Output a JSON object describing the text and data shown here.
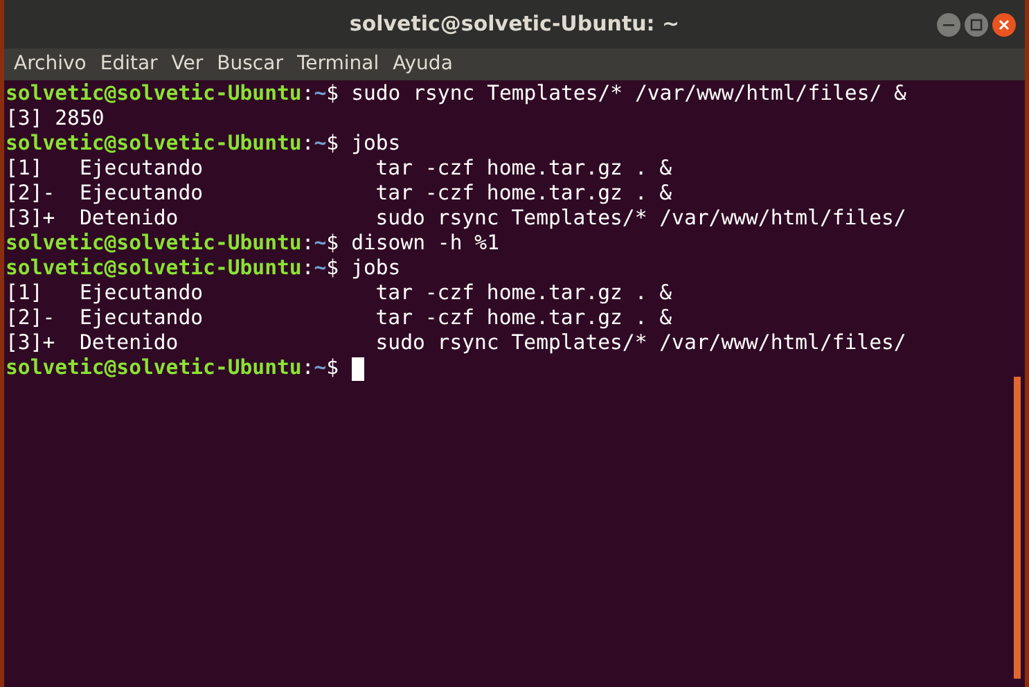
{
  "window": {
    "title": "solvetic@solvetic-Ubuntu: ~"
  },
  "menu": [
    "Archivo",
    "Editar",
    "Ver",
    "Buscar",
    "Terminal",
    "Ayuda"
  ],
  "terminal": {
    "lines": [
      {
        "kind": "prompt",
        "user_host": "solvetic@solvetic-Ubuntu",
        "separator": ":",
        "dir": "~",
        "symbol": "$",
        "command": "sudo rsync Templates/* /var/www/html/files/ &",
        "cursor": false
      },
      {
        "kind": "output",
        "text": "[3] 2850"
      },
      {
        "kind": "prompt",
        "user_host": "solvetic@solvetic-Ubuntu",
        "separator": ":",
        "dir": "~",
        "symbol": "$",
        "command": "jobs",
        "cursor": false
      },
      {
        "kind": "output",
        "text": "[1]   Ejecutando              tar -czf home.tar.gz . &"
      },
      {
        "kind": "output",
        "text": "[2]-  Ejecutando              tar -czf home.tar.gz . &"
      },
      {
        "kind": "output",
        "text": "[3]+  Detenido                sudo rsync Templates/* /var/www/html/files/"
      },
      {
        "kind": "prompt",
        "user_host": "solvetic@solvetic-Ubuntu",
        "separator": ":",
        "dir": "~",
        "symbol": "$",
        "command": "disown -h %1",
        "cursor": false
      },
      {
        "kind": "prompt",
        "user_host": "solvetic@solvetic-Ubuntu",
        "separator": ":",
        "dir": "~",
        "symbol": "$",
        "command": "jobs",
        "cursor": false
      },
      {
        "kind": "output",
        "text": "[1]   Ejecutando              tar -czf home.tar.gz . &"
      },
      {
        "kind": "output",
        "text": "[2]-  Ejecutando              tar -czf home.tar.gz . &"
      },
      {
        "kind": "output",
        "text": "[3]+  Detenido                sudo rsync Templates/* /var/www/html/files/"
      },
      {
        "kind": "prompt",
        "user_host": "solvetic@solvetic-Ubuntu",
        "separator": ":",
        "dir": "~",
        "symbol": "$",
        "cursor": true
      }
    ]
  }
}
